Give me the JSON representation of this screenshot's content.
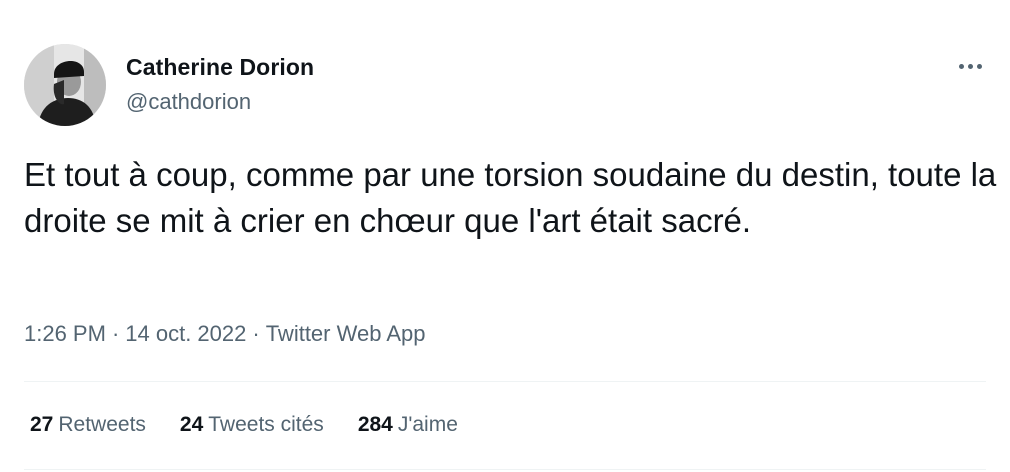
{
  "author": {
    "display_name": "Catherine Dorion",
    "handle": "@cathdorion"
  },
  "more_icon": "more-dots-icon",
  "tweet": {
    "text": "Et tout à coup, comme par une torsion soudaine du destin, toute la droite se mit à crier en chœur que l'art était sacré.",
    "time": "1:26 PM",
    "date": "14 oct. 2022",
    "source": "Twitter Web App",
    "separator": "·"
  },
  "stats": {
    "retweets": {
      "count": "27",
      "label": "Retweets"
    },
    "quotes": {
      "count": "24",
      "label": "Tweets cités"
    },
    "likes": {
      "count": "284",
      "label": "J'aime"
    }
  },
  "colors": {
    "text": "#0f1419",
    "secondary": "#536471",
    "divider": "#eff3f4"
  }
}
